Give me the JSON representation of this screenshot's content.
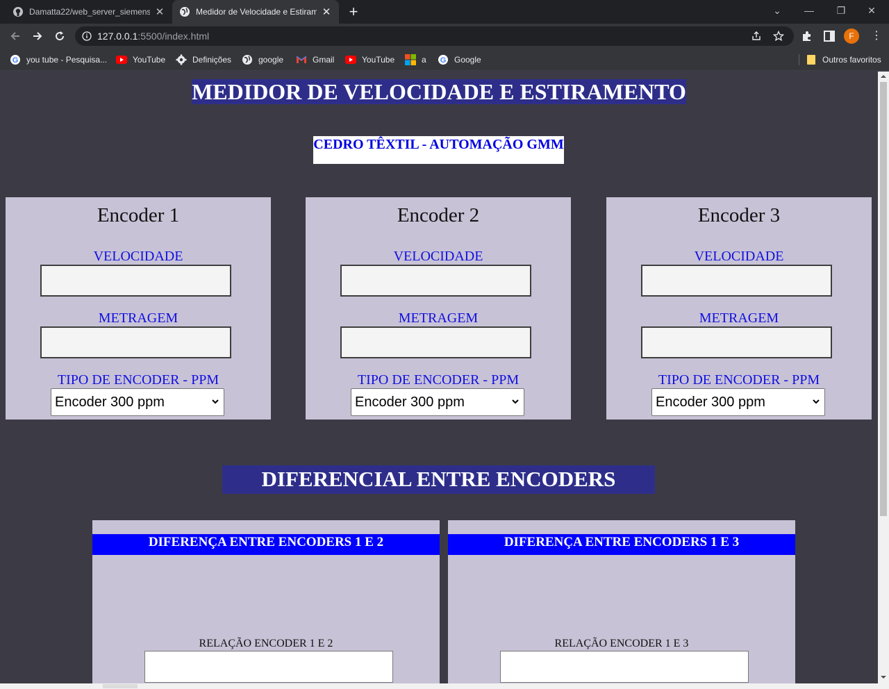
{
  "browser": {
    "tabs": [
      {
        "title": "Damatta22/web_server_siemens",
        "active": false
      },
      {
        "title": "Medidor de Velocidade e Estiram",
        "active": true
      }
    ],
    "url_host": "127.0.0.1",
    "url_rest": ":5500/index.html",
    "profile_initial": "F",
    "bookmarks": [
      {
        "label": "you tube - Pesquisa...",
        "icon": "google-icon"
      },
      {
        "label": "YouTube",
        "icon": "youtube-icon"
      },
      {
        "label": "Definições",
        "icon": "gear-icon"
      },
      {
        "label": "google",
        "icon": "globe-icon"
      },
      {
        "label": "Gmail",
        "icon": "gmail-icon"
      },
      {
        "label": "YouTube",
        "icon": "youtube-icon"
      },
      {
        "label": "a",
        "icon": "microsoft-icon"
      },
      {
        "label": "Google",
        "icon": "google-icon"
      }
    ],
    "other_bookmarks": "Outros favoritos"
  },
  "page": {
    "title": "MEDIDOR DE VELOCIDADE E ESTIRAMENTO",
    "subtitle": "CEDRO TÊXTIL - AUTOMAÇÃO GMM",
    "encoders": [
      {
        "name": "Encoder 1",
        "speed_label": "VELOCIDADE",
        "length_label": "METRAGEM",
        "type_label": "TIPO DE ENCODER - PPM",
        "selected": "Encoder 300 ppm"
      },
      {
        "name": "Encoder 2",
        "speed_label": "VELOCIDADE",
        "length_label": "METRAGEM",
        "type_label": "TIPO DE ENCODER - PPM",
        "selected": "Encoder 300 ppm"
      },
      {
        "name": "Encoder 3",
        "speed_label": "VELOCIDADE",
        "length_label": "METRAGEM",
        "type_label": "TIPO DE ENCODER - PPM",
        "selected": "Encoder 300 ppm"
      }
    ],
    "diff_title": "DIFERENCIAL ENTRE ENCODERS",
    "diffs": [
      {
        "heading": "DIFERENÇA ENTRE ENCODERS 1 E 2",
        "relation_label": "RELAÇÃO ENCODER 1 E 2"
      },
      {
        "heading": "DIFERENÇA ENTRE ENCODERS 1 E 3",
        "relation_label": "RELAÇÃO ENCODER 1 E 3"
      }
    ]
  },
  "colors": {
    "page_bg": "#3c3a45",
    "title_bg": "#2e2e8a",
    "card_bg": "#c8c2d6",
    "label_blue": "#1010e0",
    "diff_head_bg": "#0000ff"
  }
}
